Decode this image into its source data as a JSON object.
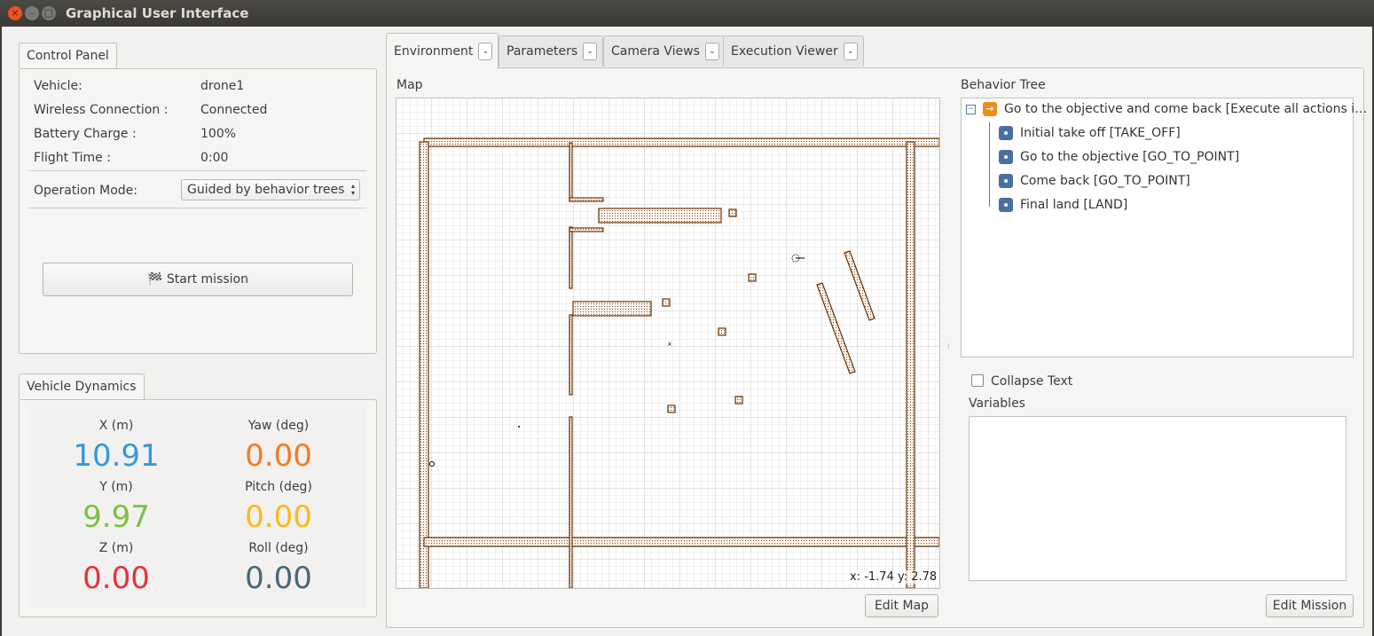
{
  "window": {
    "title": "Graphical User Interface"
  },
  "control_panel": {
    "tab_label": "Control Panel",
    "rows": [
      {
        "label": "Vehicle:",
        "value": "drone1"
      },
      {
        "label": "Wireless Connection :",
        "value": "Connected"
      },
      {
        "label": "Battery Charge :",
        "value": "100%"
      },
      {
        "label": "Flight Time :",
        "value": "0:00"
      }
    ],
    "operation_mode_label": "Operation Mode:",
    "operation_mode_value": "Guided by behavior trees",
    "start_mission_label": "Start mission"
  },
  "vehicle_dynamics": {
    "tab_label": "Vehicle Dynamics",
    "items": [
      {
        "label": "X (m)",
        "value": "10.91",
        "color": "#3598dc"
      },
      {
        "label": "Yaw (deg)",
        "value": "0.00",
        "color": "#f47b20"
      },
      {
        "label": "Y (m)",
        "value": "9.97",
        "color": "#7ac143"
      },
      {
        "label": "Pitch (deg)",
        "value": "0.00",
        "color": "#fbb917"
      },
      {
        "label": "Z (m)",
        "value": "0.00",
        "color": "#e8323c"
      },
      {
        "label": "Roll (deg)",
        "value": "0.00",
        "color": "#4a6778"
      }
    ]
  },
  "tabs": [
    {
      "label": "Environment",
      "active": true
    },
    {
      "label": "Parameters"
    },
    {
      "label": "Camera Views"
    },
    {
      "label": "Execution Viewer"
    }
  ],
  "map": {
    "title": "Map",
    "coordinates": "x: -1.74 y: 2.78",
    "edit_button": "Edit Map"
  },
  "behavior_tree": {
    "title": "Behavior Tree",
    "root": "Go to the objective and come back [Execute all actions i…",
    "children": [
      "Initial take off [TAKE_OFF]",
      "Go to the objective [GO_TO_POINT]",
      "Come back [GO_TO_POINT]",
      "Final land [LAND]"
    ],
    "collapse_text_label": "Collapse Text",
    "collapse_text_checked": false,
    "variables_label": "Variables",
    "edit_button": "Edit Mission"
  }
}
